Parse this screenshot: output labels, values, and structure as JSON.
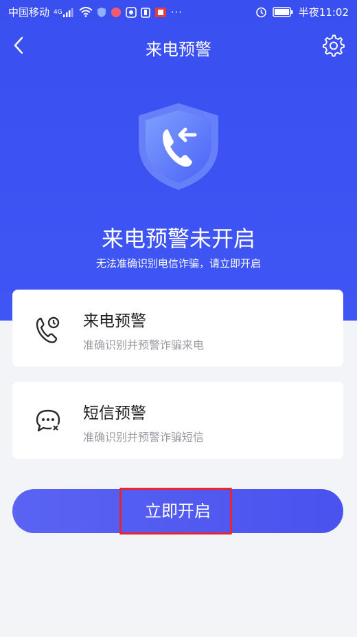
{
  "status_bar": {
    "carrier": "中国移动",
    "network": "4G",
    "dots": "···",
    "time": "半夜11:02"
  },
  "nav": {
    "title": "来电预警"
  },
  "hero": {
    "title": "来电预警未开启",
    "subtitle": "无法准确识别电信诈骗，请立即开启"
  },
  "cards": [
    {
      "title": "来电预警",
      "desc": "准确识别并预警诈骗来电",
      "icon": "phone-alert-icon"
    },
    {
      "title": "短信预警",
      "desc": "准确识别并预警诈骗短信",
      "icon": "message-alert-icon"
    }
  ],
  "action": {
    "label": "立即开启"
  },
  "colors": {
    "primary": "#3f55f4",
    "highlight": "#e8262d",
    "background": "#f3f4f8"
  }
}
